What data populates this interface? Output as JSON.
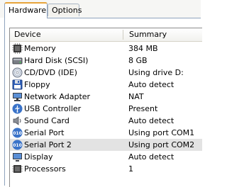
{
  "tabs": [
    {
      "label": "Hardware",
      "active": true
    },
    {
      "label": "Options",
      "active": false
    }
  ],
  "columns": {
    "device": "Device",
    "summary": "Summary"
  },
  "devices": [
    {
      "name": "Memory",
      "summary": "384 MB",
      "icon": "memory-icon"
    },
    {
      "name": "Hard Disk (SCSI)",
      "summary": "8 GB",
      "icon": "hard-disk-icon"
    },
    {
      "name": "CD/DVD (IDE)",
      "summary": "Using drive D:",
      "icon": "cd-dvd-icon"
    },
    {
      "name": "Floppy",
      "summary": "Auto detect",
      "icon": "floppy-icon"
    },
    {
      "name": "Network Adapter",
      "summary": "NAT",
      "icon": "network-adapter-icon"
    },
    {
      "name": "USB Controller",
      "summary": "Present",
      "icon": "usb-controller-icon"
    },
    {
      "name": "Sound Card",
      "summary": "Auto detect",
      "icon": "sound-card-icon"
    },
    {
      "name": "Serial Port",
      "summary": "Using port COM1",
      "icon": "serial-port-icon"
    },
    {
      "name": "Serial Port 2",
      "summary": "Using port COM2",
      "icon": "serial-port-icon",
      "selected": true
    },
    {
      "name": "Display",
      "summary": "Auto detect",
      "icon": "display-icon"
    },
    {
      "name": "Processors",
      "summary": "1",
      "icon": "processor-icon"
    }
  ],
  "colors": {
    "tab_accent": "#e7a43a",
    "selection": "#e3e3e3",
    "icon_blue": "#3a73c9"
  }
}
